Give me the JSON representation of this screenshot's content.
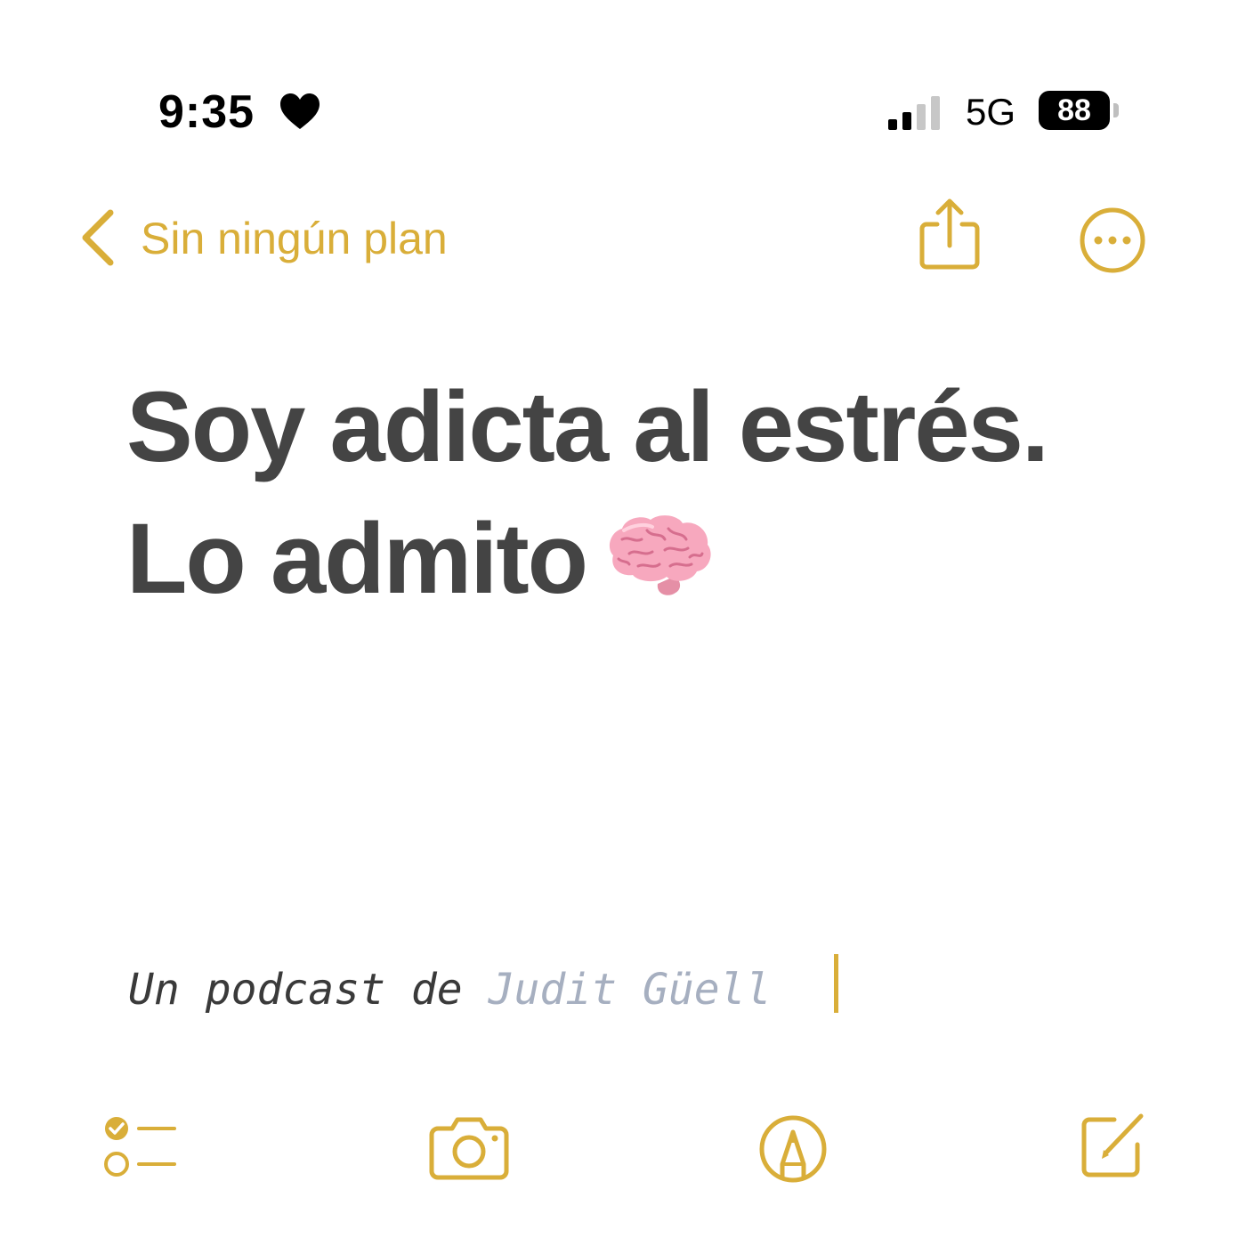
{
  "status_bar": {
    "time": "9:35",
    "heart_icon": "heart-icon",
    "signal_icon": "cellular-signal-icon",
    "network": "5G",
    "battery_level": "88"
  },
  "nav": {
    "back_icon": "chevron-left-icon",
    "back_label": "Sin ningún plan",
    "share_icon": "share-icon",
    "more_icon": "ellipsis-circle-icon"
  },
  "note": {
    "title_line1": "Soy adicta al estrés.",
    "title_line2": "Lo admito",
    "title_emoji": "brain-emoji",
    "byline_prefix": "Un podcast de ",
    "byline_author": "Judit Güell"
  },
  "toolbar": {
    "checklist_icon": "checklist-icon",
    "camera_icon": "camera-icon",
    "markup_icon": "markup-pen-icon",
    "compose_icon": "compose-icon"
  },
  "colors": {
    "accent": "#D9AE39",
    "title_text": "#444444",
    "author_text": "#A6AFC0"
  }
}
